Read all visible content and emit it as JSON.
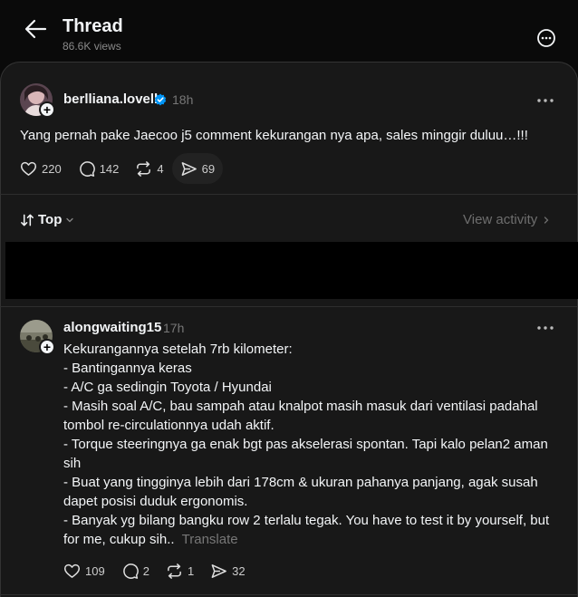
{
  "header": {
    "title": "Thread",
    "views": "86.6K views"
  },
  "post": {
    "username": "berlliana.lovell",
    "time": "18h",
    "text": "Yang pernah pake Jaecoo j5 comment kekurangan nya apa, sales minggir duluu…!!!",
    "likes": "220",
    "comments": "142",
    "reposts": "4",
    "shares": "69"
  },
  "sort": {
    "label": "Top",
    "view_activity": "View activity"
  },
  "reply": {
    "username": "alongwaiting15",
    "time": "17h",
    "text": "Kekurangannya setelah 7rb kilometer:\n- Bantingannya keras\n- A/C ga sedingin Toyota / Hyundai\n- Masih soal A/C, bau sampah atau knalpot masih masuk dari ventilasi padahal tombol re-circulationnya udah aktif.\n- Torque steeringnya ga enak bgt pas akselerasi spontan. Tapi kalo pelan2 aman sih\n- Buat yang tingginya lebih dari 178cm & ukuran pahanya panjang, agak susah dapet posisi duduk ergonomis.\n- Banyak yg bilang bangku row 2 terlalu tegak. You have to test it by yourself, but for me, cukup sih..",
    "translate": "Translate",
    "likes": "109",
    "comments": "2",
    "reposts": "1",
    "shares": "32"
  },
  "colors": {
    "background": "#0a0a0a",
    "card": "#181818",
    "verified": "#0095f6"
  }
}
